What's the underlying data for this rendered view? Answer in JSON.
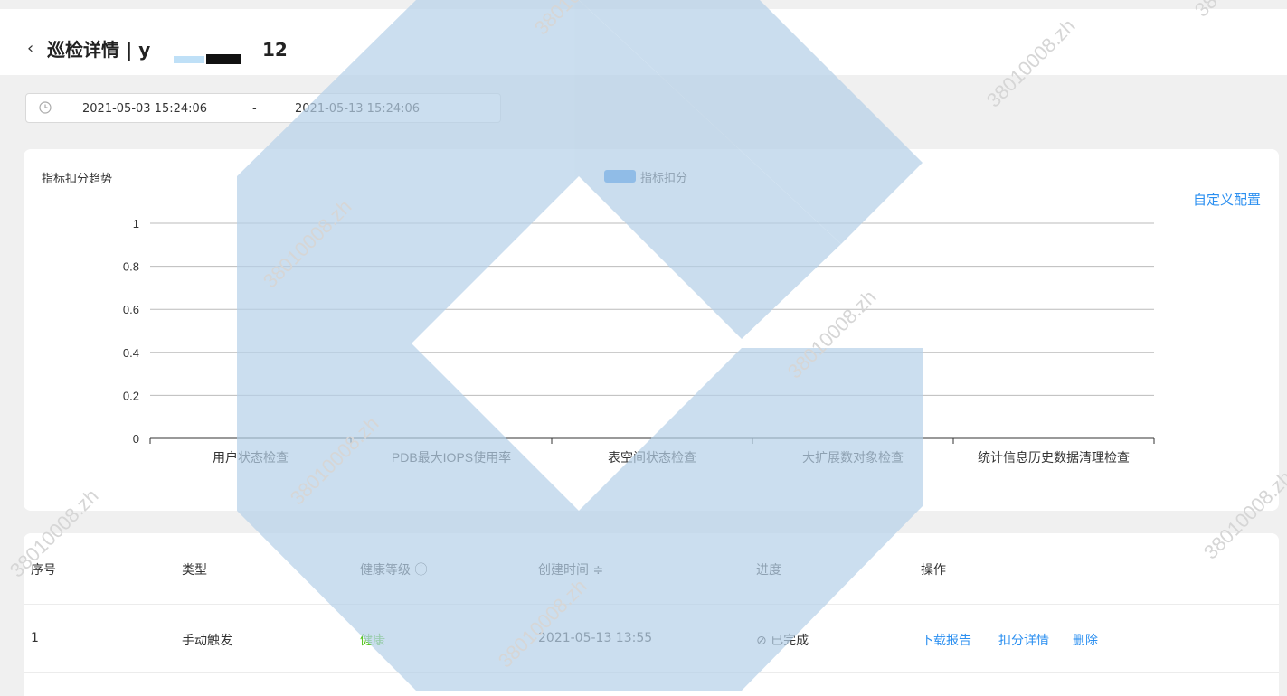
{
  "header": {
    "back_icon": "chevron-left-icon",
    "title": "巡检详情 | y",
    "title_suffix": "12"
  },
  "date_range": {
    "icon": "clock-icon",
    "start": "2021-05-03 15:24:06",
    "separator": "-",
    "end": "2021-05-13 15:24:06"
  },
  "chart_card": {
    "custom_config_label": "自定义配置"
  },
  "chart_data": {
    "type": "bar",
    "title": "指标扣分趋势",
    "categories": [
      "用户状态检查",
      "PDB最大IOPS使用率",
      "表空间状态检查",
      "大扩展数对象检查",
      "统计信息历史数据清理检查"
    ],
    "series": [
      {
        "name": "指标扣分",
        "values": [
          0,
          0,
          0,
          0,
          0
        ],
        "color": "#3a8ee6"
      }
    ],
    "yticks": [
      "1",
      "0.8",
      "0.6",
      "0.4",
      "0.2",
      "0"
    ],
    "ylim": [
      0,
      1
    ],
    "grid": true,
    "legend_position": "top-center"
  },
  "table": {
    "columns": [
      "序号",
      "类型",
      "健康等级 ⓘ",
      "创建时间 ≑",
      "进度",
      "操作"
    ],
    "rows": [
      {
        "index": "1",
        "type": "手动触发",
        "health": "健康",
        "created": "2021-05-13 13:55",
        "progress": "⊘ 已完成",
        "actions": [
          "下载报告",
          "扣分详情",
          "删除"
        ]
      }
    ]
  },
  "watermark": {
    "text": "38010008.zh",
    "color": "#b5d0e8"
  }
}
